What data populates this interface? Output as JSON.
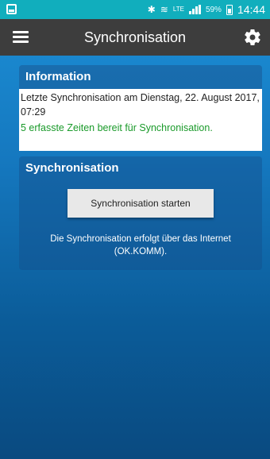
{
  "status_bar": {
    "battery_percent": "59%",
    "time": "14:44",
    "network_label": "LTE",
    "icons": [
      "screenshot-icon",
      "bluetooth-icon",
      "mute-icon",
      "lte-icon",
      "signal-icon",
      "battery-icon"
    ]
  },
  "app_bar": {
    "title": "Synchronisation",
    "menu_icon": "hamburger-menu-icon",
    "settings_icon": "gear-icon"
  },
  "information": {
    "header": "Information",
    "last_sync": "Letzte Synchronisation am Dienstag, 22. August 2017, 07:29",
    "pending": "5 erfasste Zeiten bereit für Synchronisation.",
    "pending_color": "#1a9a2a"
  },
  "synchronisation": {
    "header": "Synchronisation",
    "button_label": "Synchronisation starten",
    "note": "Die Synchronisation erfolgt über das Internet (OK.KOMM)."
  },
  "colors": {
    "status_bar": "#11aebd",
    "app_bar": "#3d3d3d",
    "background_top": "#1c8fd6",
    "background_bottom": "#0a4a80"
  }
}
